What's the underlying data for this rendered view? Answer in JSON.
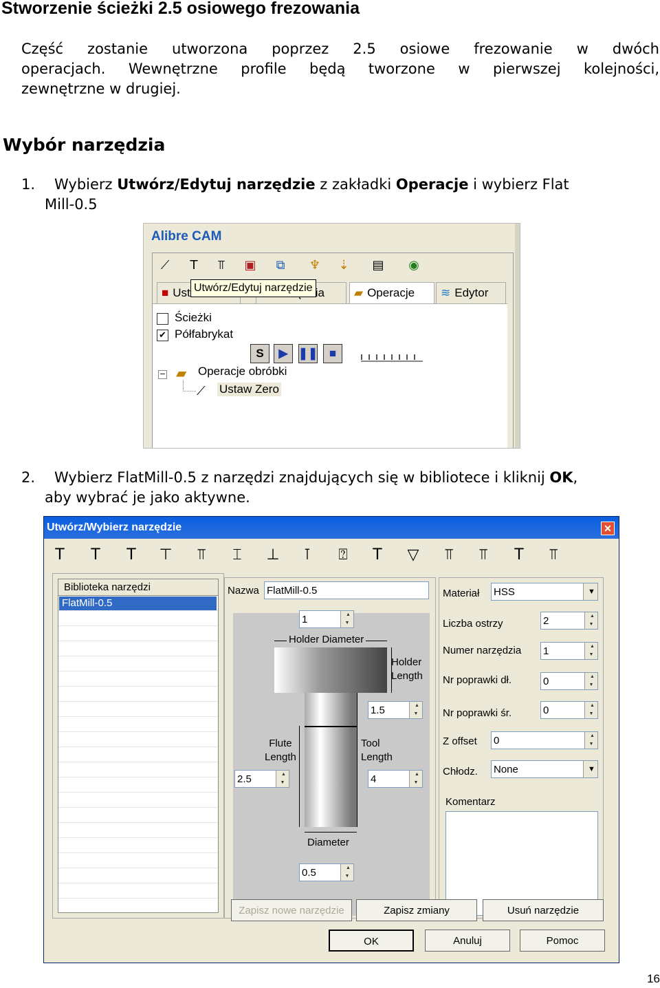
{
  "title": "Stworzenie ścieżki 2.5 osiowego frezowania",
  "intro": {
    "line1": "Część zostanie utworzona poprzez 2.5 osiowe frezowanie w dwóch",
    "line2": "operacjach. Wewnętrzne profile będą tworzone w pierwszej kolejności,",
    "line3": "zewnętrzne w drugiej."
  },
  "section_title": "Wybór narzędzia",
  "step1": {
    "number": "1.",
    "pre": "Wybierz ",
    "bold1": "Utwórz/Edytuj narzędzie",
    "mid": " z zakładki ",
    "bold2": "Operacje",
    "post": " i wybierz Flat",
    "cont": "Mill-0.5"
  },
  "step2": {
    "number": "2.",
    "pre": "Wybierz FlatMill-0.5 z narzędzi znajdujących się w bibliotece i kliknij ",
    "bold": "OK",
    "post": ",",
    "cont": "aby wybrać je jako aktywne."
  },
  "cam": {
    "title": "Alibre CAM",
    "tooltip": "Utwórz/Edytuj narzędzie",
    "tabs": {
      "settings": "Ustawienia",
      "tools": "Narzędzia",
      "operations": "Operacje",
      "editor": "Edytor"
    },
    "checks": {
      "paths": "Ścieżki",
      "stock": "Półfabrykat"
    },
    "play_labels": {
      "s": "S"
    },
    "tree": {
      "root": "Operacje obróbki",
      "child": "Ustaw Zero"
    }
  },
  "dialog": {
    "title": "Utwórz/Wybierz narzędzie",
    "library_header": "Biblioteka narzędzi",
    "library_items": [
      "FlatMill-0.5"
    ],
    "name_label": "Nazwa",
    "name_value": "FlatMill-0.5",
    "diagram": {
      "top_value": "1",
      "holder_diameter": "Holder Diameter",
      "holder_length": "Holder\nLength",
      "holder_length_value": "1.5",
      "flute_length": "Flute\nLength",
      "flute_length_value": "2.5",
      "tool_length": "Tool\nLength",
      "tool_length_value": "4",
      "diameter": "Diameter",
      "diameter_value": "0.5"
    },
    "props": {
      "material_label": "Materiał",
      "material_value": "HSS",
      "flutes_label": "Liczba ostrzy",
      "flutes_value": "2",
      "tool_no_label": "Numer narzędzia",
      "tool_no_value": "1",
      "len_off_label": "Nr poprawki dł.",
      "len_off_value": "0",
      "dia_off_label": "Nr poprawki śr.",
      "dia_off_value": "0",
      "z_offset_label": "Z offset",
      "z_offset_value": "0",
      "coolant_label": "Chłodz.",
      "coolant_value": "None",
      "comment_label": "Komentarz"
    },
    "buttons": {
      "save_new": "Zapisz nowe narzędzie",
      "save_changes": "Zapisz zmiany",
      "delete": "Usuń narzędzie",
      "ok": "OK",
      "cancel": "Anuluj",
      "help": "Pomoc"
    }
  },
  "page_number": "16"
}
